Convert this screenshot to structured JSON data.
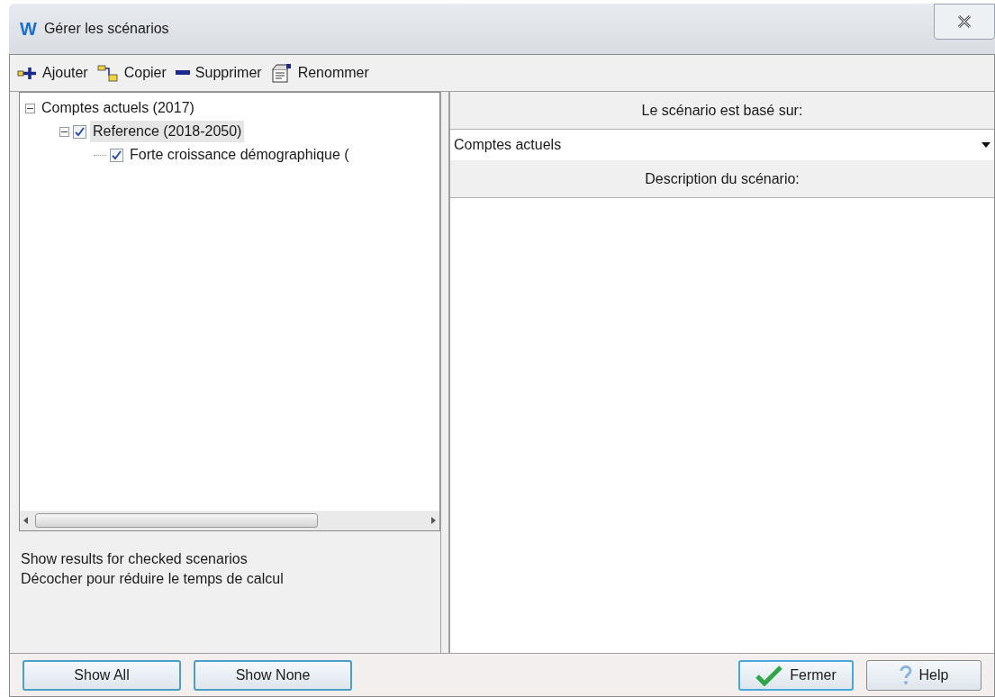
{
  "window": {
    "logo": "W",
    "title": "Gérer les scénarios"
  },
  "toolbar": [
    {
      "kind": "add",
      "label": "Ajouter"
    },
    {
      "kind": "copy",
      "label": "Copier"
    },
    {
      "kind": "delete",
      "label": "Supprimer"
    },
    {
      "kind": "rename",
      "label": "Renommer"
    }
  ],
  "tree": [
    {
      "label": "Comptes actuels (2017)",
      "expanded": true,
      "selected": false,
      "children": [
        {
          "label": "Reference (2018-2050)",
          "expanded": true,
          "checked": true,
          "selected": true,
          "children": [
            {
              "label": "Forte croissance démographique (",
              "checked": true,
              "selected": false
            }
          ]
        }
      ]
    }
  ],
  "notes": [
    "Show results for checked scenarios",
    "Décocher pour réduire le temps de calcul"
  ],
  "based_on": {
    "heading": "Le scénario est basé sur:",
    "value": "Comptes actuels"
  },
  "description": {
    "heading": "Description du scénario:"
  },
  "buttons": [
    {
      "kind": "plain",
      "label": "Show All"
    },
    {
      "kind": "plain",
      "label": "Show None"
    },
    {
      "kind": "ok",
      "label": "Fermer"
    },
    {
      "kind": "help",
      "label": "Help"
    }
  ]
}
